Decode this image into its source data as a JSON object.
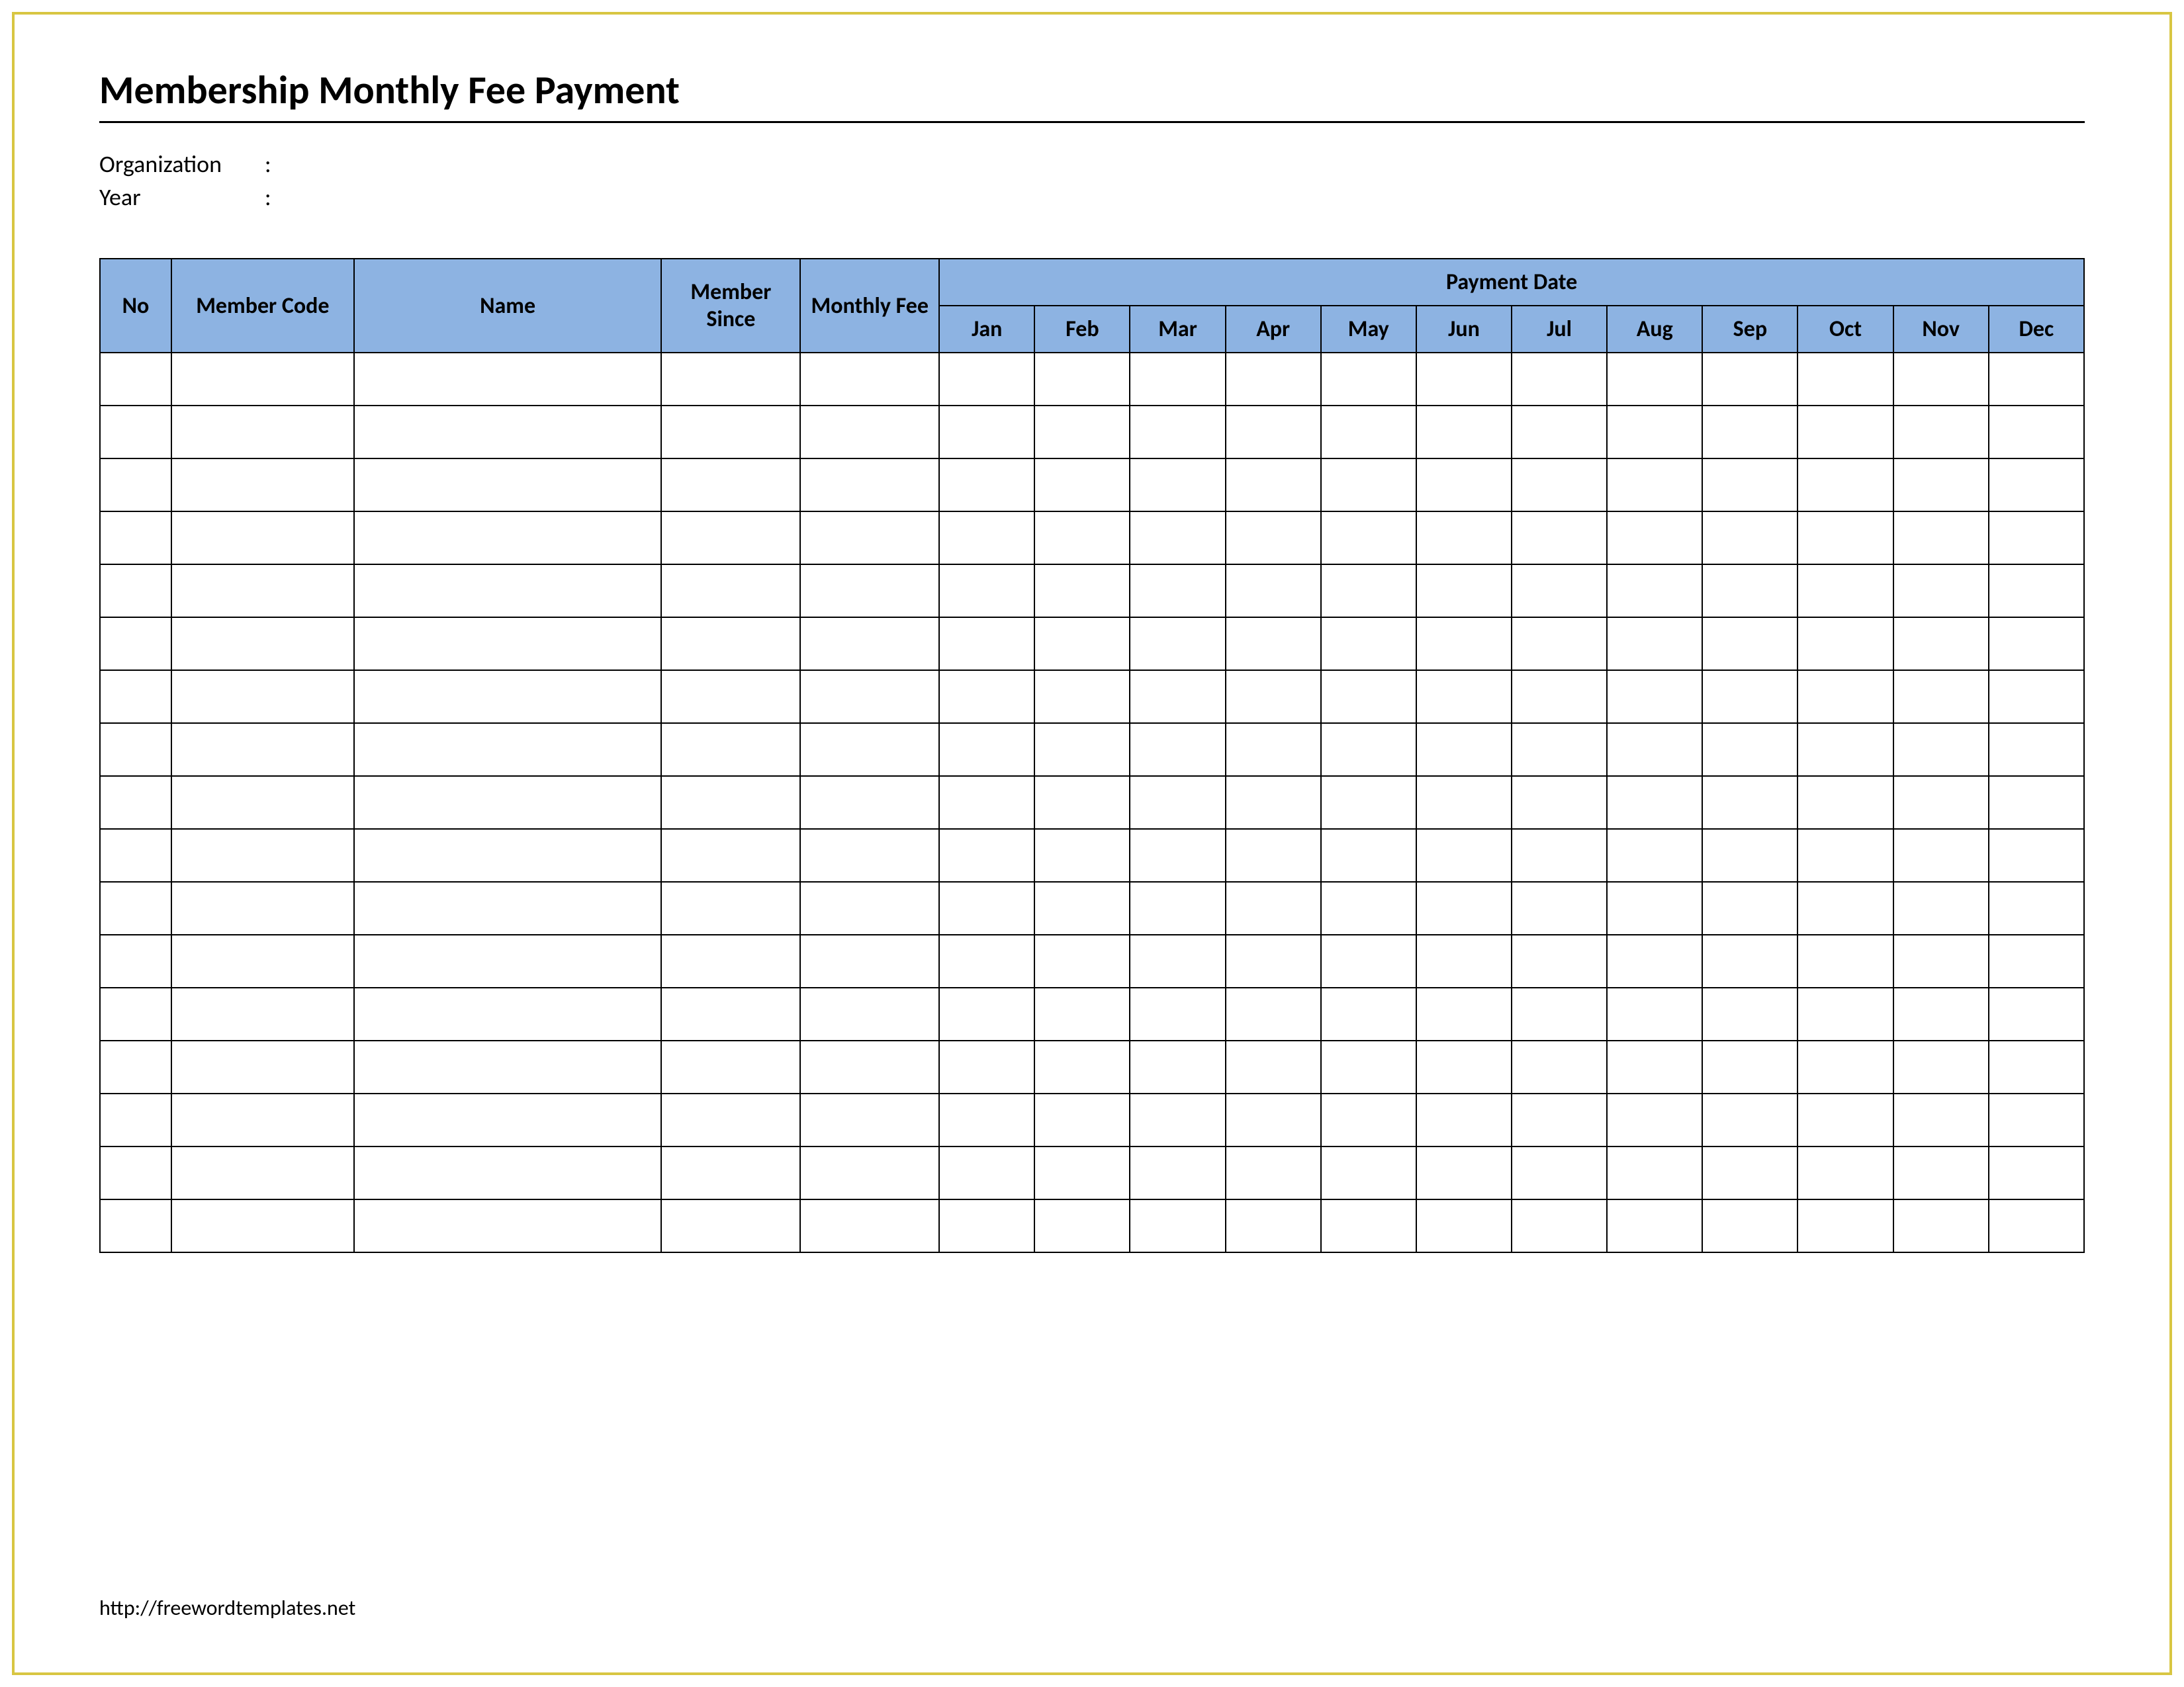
{
  "title": "Membership Monthly Fee Payment",
  "meta": {
    "organization_label": "Organization",
    "year_label": "Year",
    "colon": ":",
    "organization_value": "",
    "year_value": ""
  },
  "table": {
    "headers": {
      "no": "No",
      "member_code": "Member Code",
      "name": "Name",
      "member_since": "Member Since",
      "monthly_fee": "Monthly Fee",
      "payment_date": "Payment Date"
    },
    "months": [
      "Jan",
      "Feb",
      "Mar",
      "Apr",
      "May",
      "Jun",
      "Jul",
      "Aug",
      "Sep",
      "Oct",
      "Nov",
      "Dec"
    ],
    "rows": [
      {
        "no": "",
        "code": "",
        "name": "",
        "since": "",
        "fee": "",
        "months": [
          "",
          "",
          "",
          "",
          "",
          "",
          "",
          "",
          "",
          "",
          "",
          ""
        ]
      },
      {
        "no": "",
        "code": "",
        "name": "",
        "since": "",
        "fee": "",
        "months": [
          "",
          "",
          "",
          "",
          "",
          "",
          "",
          "",
          "",
          "",
          "",
          ""
        ]
      },
      {
        "no": "",
        "code": "",
        "name": "",
        "since": "",
        "fee": "",
        "months": [
          "",
          "",
          "",
          "",
          "",
          "",
          "",
          "",
          "",
          "",
          "",
          ""
        ]
      },
      {
        "no": "",
        "code": "",
        "name": "",
        "since": "",
        "fee": "",
        "months": [
          "",
          "",
          "",
          "",
          "",
          "",
          "",
          "",
          "",
          "",
          "",
          ""
        ]
      },
      {
        "no": "",
        "code": "",
        "name": "",
        "since": "",
        "fee": "",
        "months": [
          "",
          "",
          "",
          "",
          "",
          "",
          "",
          "",
          "",
          "",
          "",
          ""
        ]
      },
      {
        "no": "",
        "code": "",
        "name": "",
        "since": "",
        "fee": "",
        "months": [
          "",
          "",
          "",
          "",
          "",
          "",
          "",
          "",
          "",
          "",
          "",
          ""
        ]
      },
      {
        "no": "",
        "code": "",
        "name": "",
        "since": "",
        "fee": "",
        "months": [
          "",
          "",
          "",
          "",
          "",
          "",
          "",
          "",
          "",
          "",
          "",
          ""
        ]
      },
      {
        "no": "",
        "code": "",
        "name": "",
        "since": "",
        "fee": "",
        "months": [
          "",
          "",
          "",
          "",
          "",
          "",
          "",
          "",
          "",
          "",
          "",
          ""
        ]
      },
      {
        "no": "",
        "code": "",
        "name": "",
        "since": "",
        "fee": "",
        "months": [
          "",
          "",
          "",
          "",
          "",
          "",
          "",
          "",
          "",
          "",
          "",
          ""
        ]
      },
      {
        "no": "",
        "code": "",
        "name": "",
        "since": "",
        "fee": "",
        "months": [
          "",
          "",
          "",
          "",
          "",
          "",
          "",
          "",
          "",
          "",
          "",
          ""
        ]
      },
      {
        "no": "",
        "code": "",
        "name": "",
        "since": "",
        "fee": "",
        "months": [
          "",
          "",
          "",
          "",
          "",
          "",
          "",
          "",
          "",
          "",
          "",
          ""
        ]
      },
      {
        "no": "",
        "code": "",
        "name": "",
        "since": "",
        "fee": "",
        "months": [
          "",
          "",
          "",
          "",
          "",
          "",
          "",
          "",
          "",
          "",
          "",
          ""
        ]
      },
      {
        "no": "",
        "code": "",
        "name": "",
        "since": "",
        "fee": "",
        "months": [
          "",
          "",
          "",
          "",
          "",
          "",
          "",
          "",
          "",
          "",
          "",
          ""
        ]
      },
      {
        "no": "",
        "code": "",
        "name": "",
        "since": "",
        "fee": "",
        "months": [
          "",
          "",
          "",
          "",
          "",
          "",
          "",
          "",
          "",
          "",
          "",
          ""
        ]
      },
      {
        "no": "",
        "code": "",
        "name": "",
        "since": "",
        "fee": "",
        "months": [
          "",
          "",
          "",
          "",
          "",
          "",
          "",
          "",
          "",
          "",
          "",
          ""
        ]
      },
      {
        "no": "",
        "code": "",
        "name": "",
        "since": "",
        "fee": "",
        "months": [
          "",
          "",
          "",
          "",
          "",
          "",
          "",
          "",
          "",
          "",
          "",
          ""
        ]
      },
      {
        "no": "",
        "code": "",
        "name": "",
        "since": "",
        "fee": "",
        "months": [
          "",
          "",
          "",
          "",
          "",
          "",
          "",
          "",
          "",
          "",
          "",
          ""
        ]
      }
    ]
  },
  "footer": "http://freewordtemplates.net"
}
